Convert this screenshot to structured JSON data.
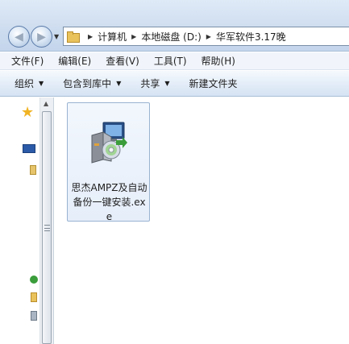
{
  "address": {
    "crumbs": [
      "计算机",
      "本地磁盘 (D:)",
      "华军软件3.17晚"
    ]
  },
  "menu": {
    "items": [
      "文件(F)",
      "编辑(E)",
      "查看(V)",
      "工具(T)",
      "帮助(H)"
    ]
  },
  "commands": {
    "organize": "组织",
    "include_library": "包含到库中",
    "share": "共享",
    "new_folder": "新建文件夹"
  },
  "files": [
    {
      "name": "思杰AMPZ及自动备份一键安装.exe",
      "icon": "installer-icon"
    }
  ],
  "colors": {
    "accent": "#99b3d1",
    "toolbar": "#d6e3f3"
  }
}
